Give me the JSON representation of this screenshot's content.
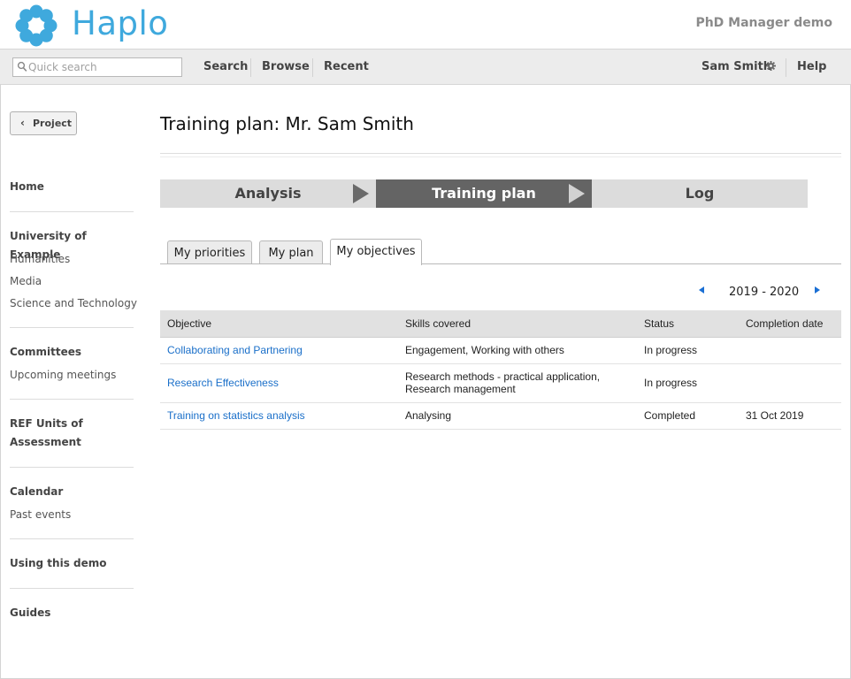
{
  "header": {
    "logo_text": "Haplo",
    "app_title": "PhD Manager demo",
    "brand_color": "#3fa9dd"
  },
  "navbar": {
    "search_placeholder": "Quick search",
    "links": [
      "Search",
      "Browse",
      "Recent"
    ],
    "user_name": "Sam Smith",
    "help_label": "Help"
  },
  "sidebar": {
    "back_button": "Project",
    "sections": [
      {
        "heading": "Home",
        "items": []
      },
      {
        "heading": "University of Example",
        "items": [
          "Humanities",
          "Media",
          "Science and Technology"
        ]
      },
      {
        "heading": "Committees",
        "items": [
          "Upcoming meetings"
        ]
      },
      {
        "heading": "REF Units of Assessment",
        "items": []
      },
      {
        "heading": "Calendar",
        "items": [
          "Past events"
        ]
      },
      {
        "heading": "Using this demo",
        "items": []
      },
      {
        "heading": "Guides",
        "items": []
      }
    ]
  },
  "main": {
    "title": "Training plan: Mr. Sam Smith",
    "steps": [
      "Analysis",
      "Training plan",
      "Log"
    ],
    "active_step": "Training plan",
    "tabs": [
      "My priorities",
      "My plan",
      "My objectives"
    ],
    "active_tab": "My objectives",
    "year_range": "2019 - 2020",
    "table": {
      "columns": [
        "Objective",
        "Skills covered",
        "Status",
        "Completion date"
      ],
      "rows": [
        {
          "objective": "Collaborating and Partnering",
          "skills": "Engagement, Working with others",
          "status": "In progress",
          "date": ""
        },
        {
          "objective": "Research Effectiveness",
          "skills": "Research methods - practical application,",
          "skills_line2": "Research management",
          "status": "In progress",
          "date": ""
        },
        {
          "objective": "Training on statistics analysis",
          "skills": "Analysing",
          "status": "Completed",
          "date": "31 Oct 2019"
        }
      ]
    }
  },
  "icons": {
    "logo": "flower-logo-icon",
    "search": "magnifier-icon",
    "settings": "gear-icon",
    "back": "chevron-left-icon",
    "prev": "triangle-left-icon",
    "next": "triangle-right-icon",
    "step_separator": "triangle-right-icon"
  },
  "colors": {
    "link": "#1a6fc9",
    "active_step_bg": "#646464",
    "inactive_step_bg": "#dcdcdc",
    "pager_arrow": "#1a6fd4"
  }
}
